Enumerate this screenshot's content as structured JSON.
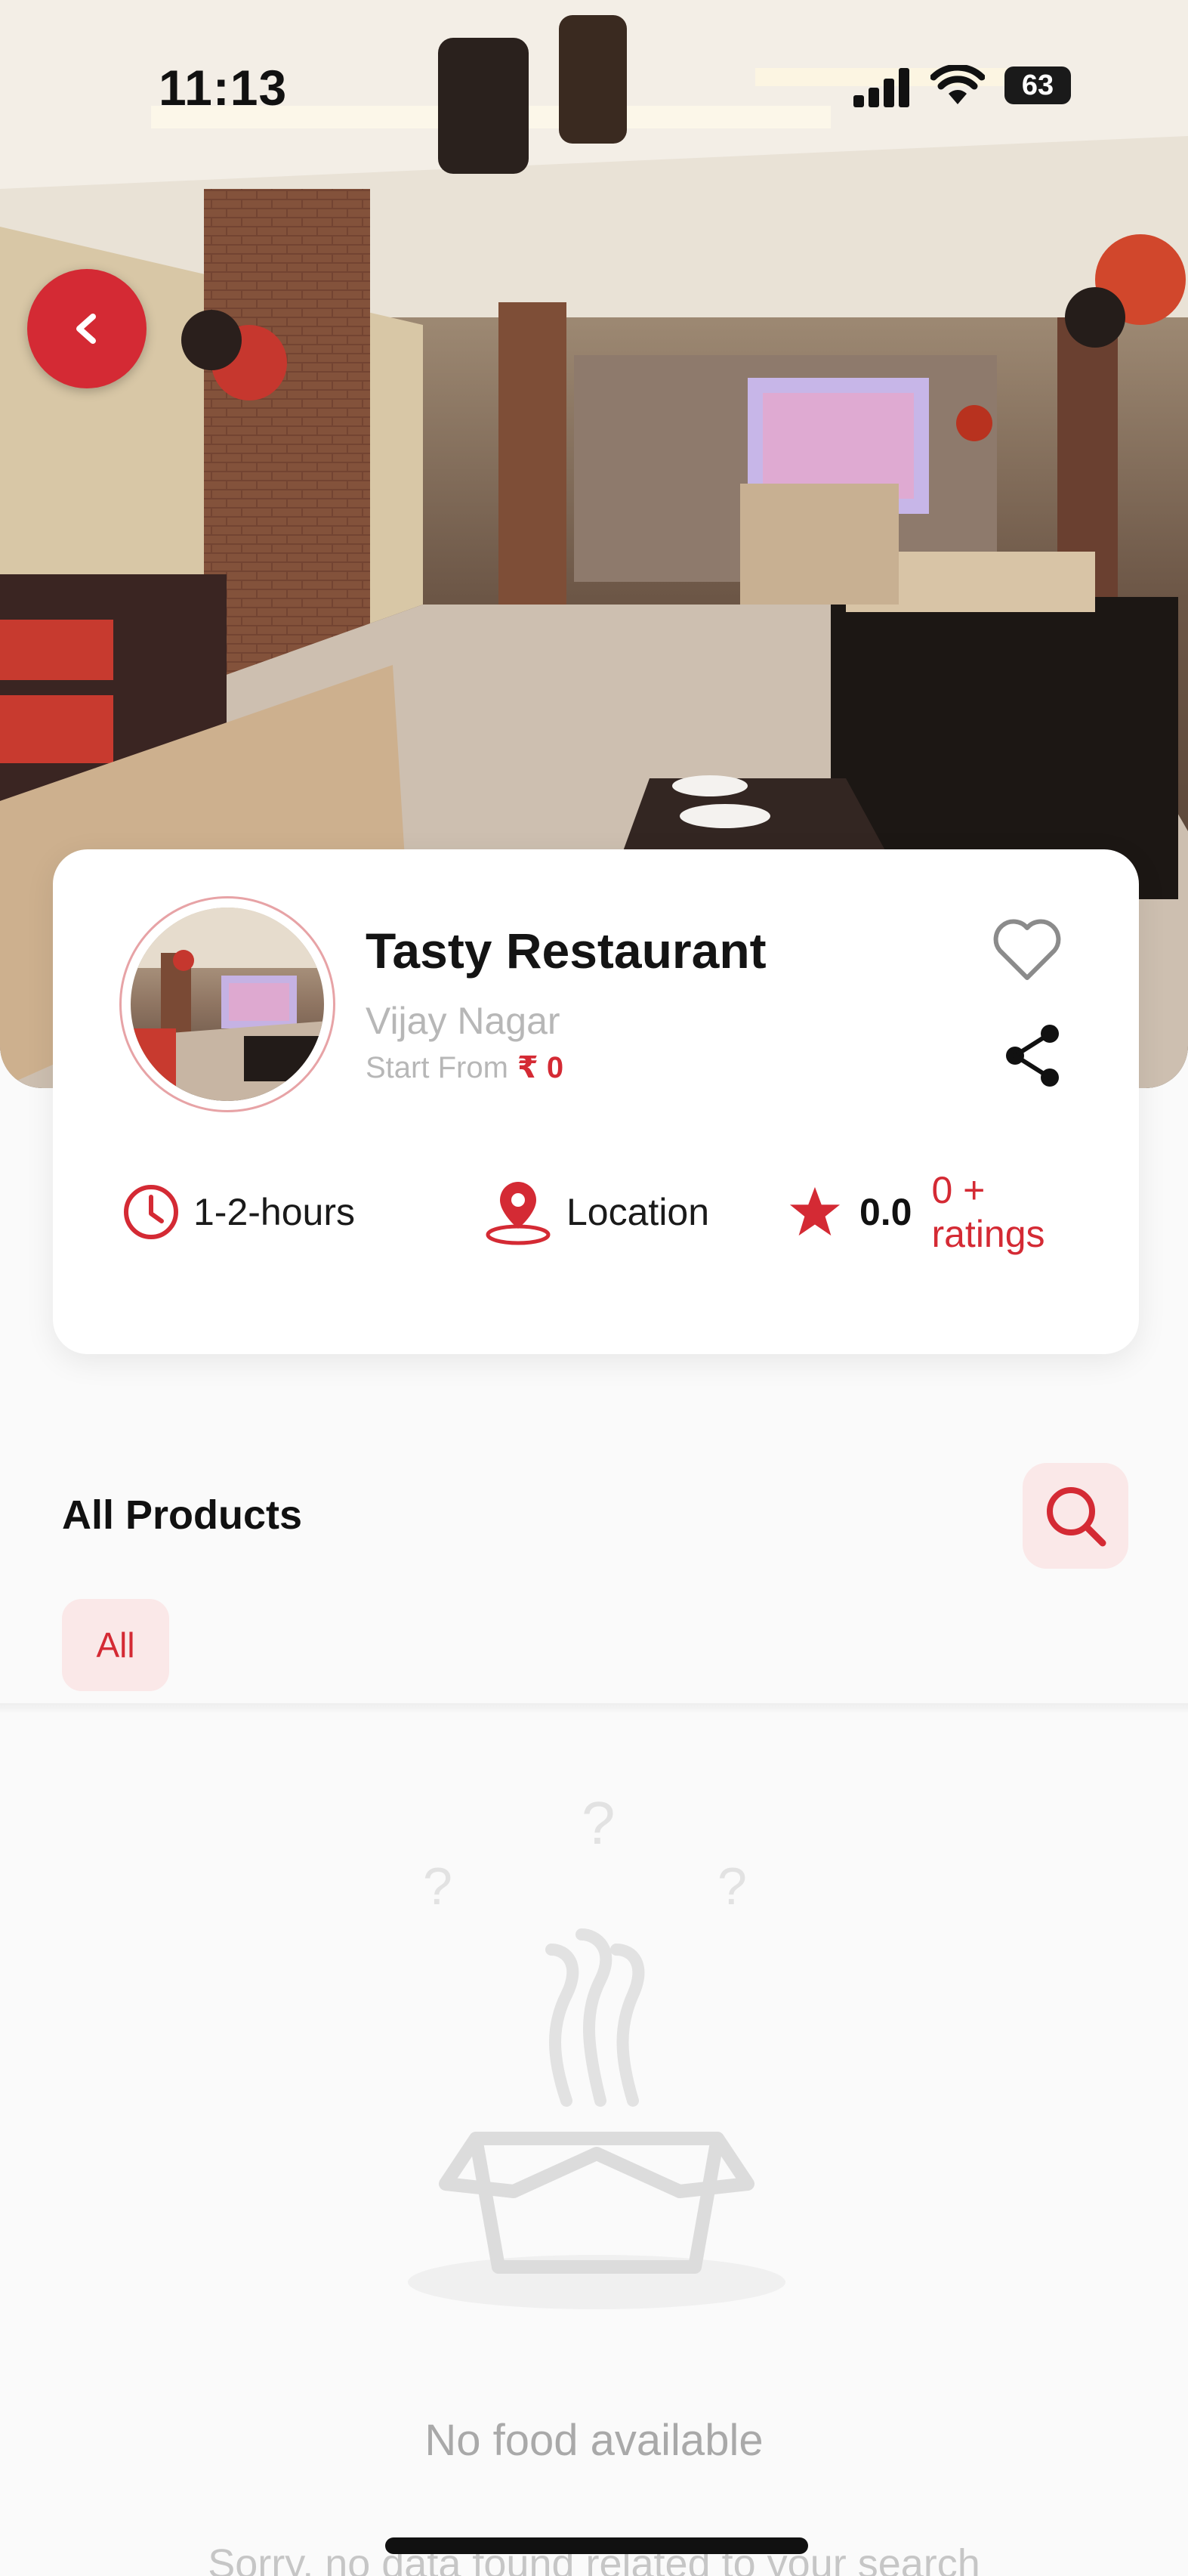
{
  "status_bar": {
    "time": "11:13",
    "battery": "63"
  },
  "header": {
    "back_icon": "chevron-left-icon"
  },
  "restaurant": {
    "name": "Tasty Restaurant",
    "area": "Vijay Nagar",
    "start_from_label": "Start From",
    "start_price": "₹ 0",
    "heart_icon": "heart-outline-icon",
    "share_icon": "share-icon",
    "duration": "1-2-hours",
    "location_label": "Location",
    "rating": "0.0",
    "ratings_count": "0 + ratings"
  },
  "products": {
    "title": "All Products",
    "search_icon": "search-icon",
    "categories": [
      {
        "label": "All",
        "selected": true
      }
    ]
  },
  "empty_state": {
    "title": "No food available",
    "subtitle": "Sorry, no data found related to your search"
  },
  "colors": {
    "accent": "#d42a34",
    "accent_soft": "#fae8e8",
    "muted": "#b7b7b7"
  }
}
